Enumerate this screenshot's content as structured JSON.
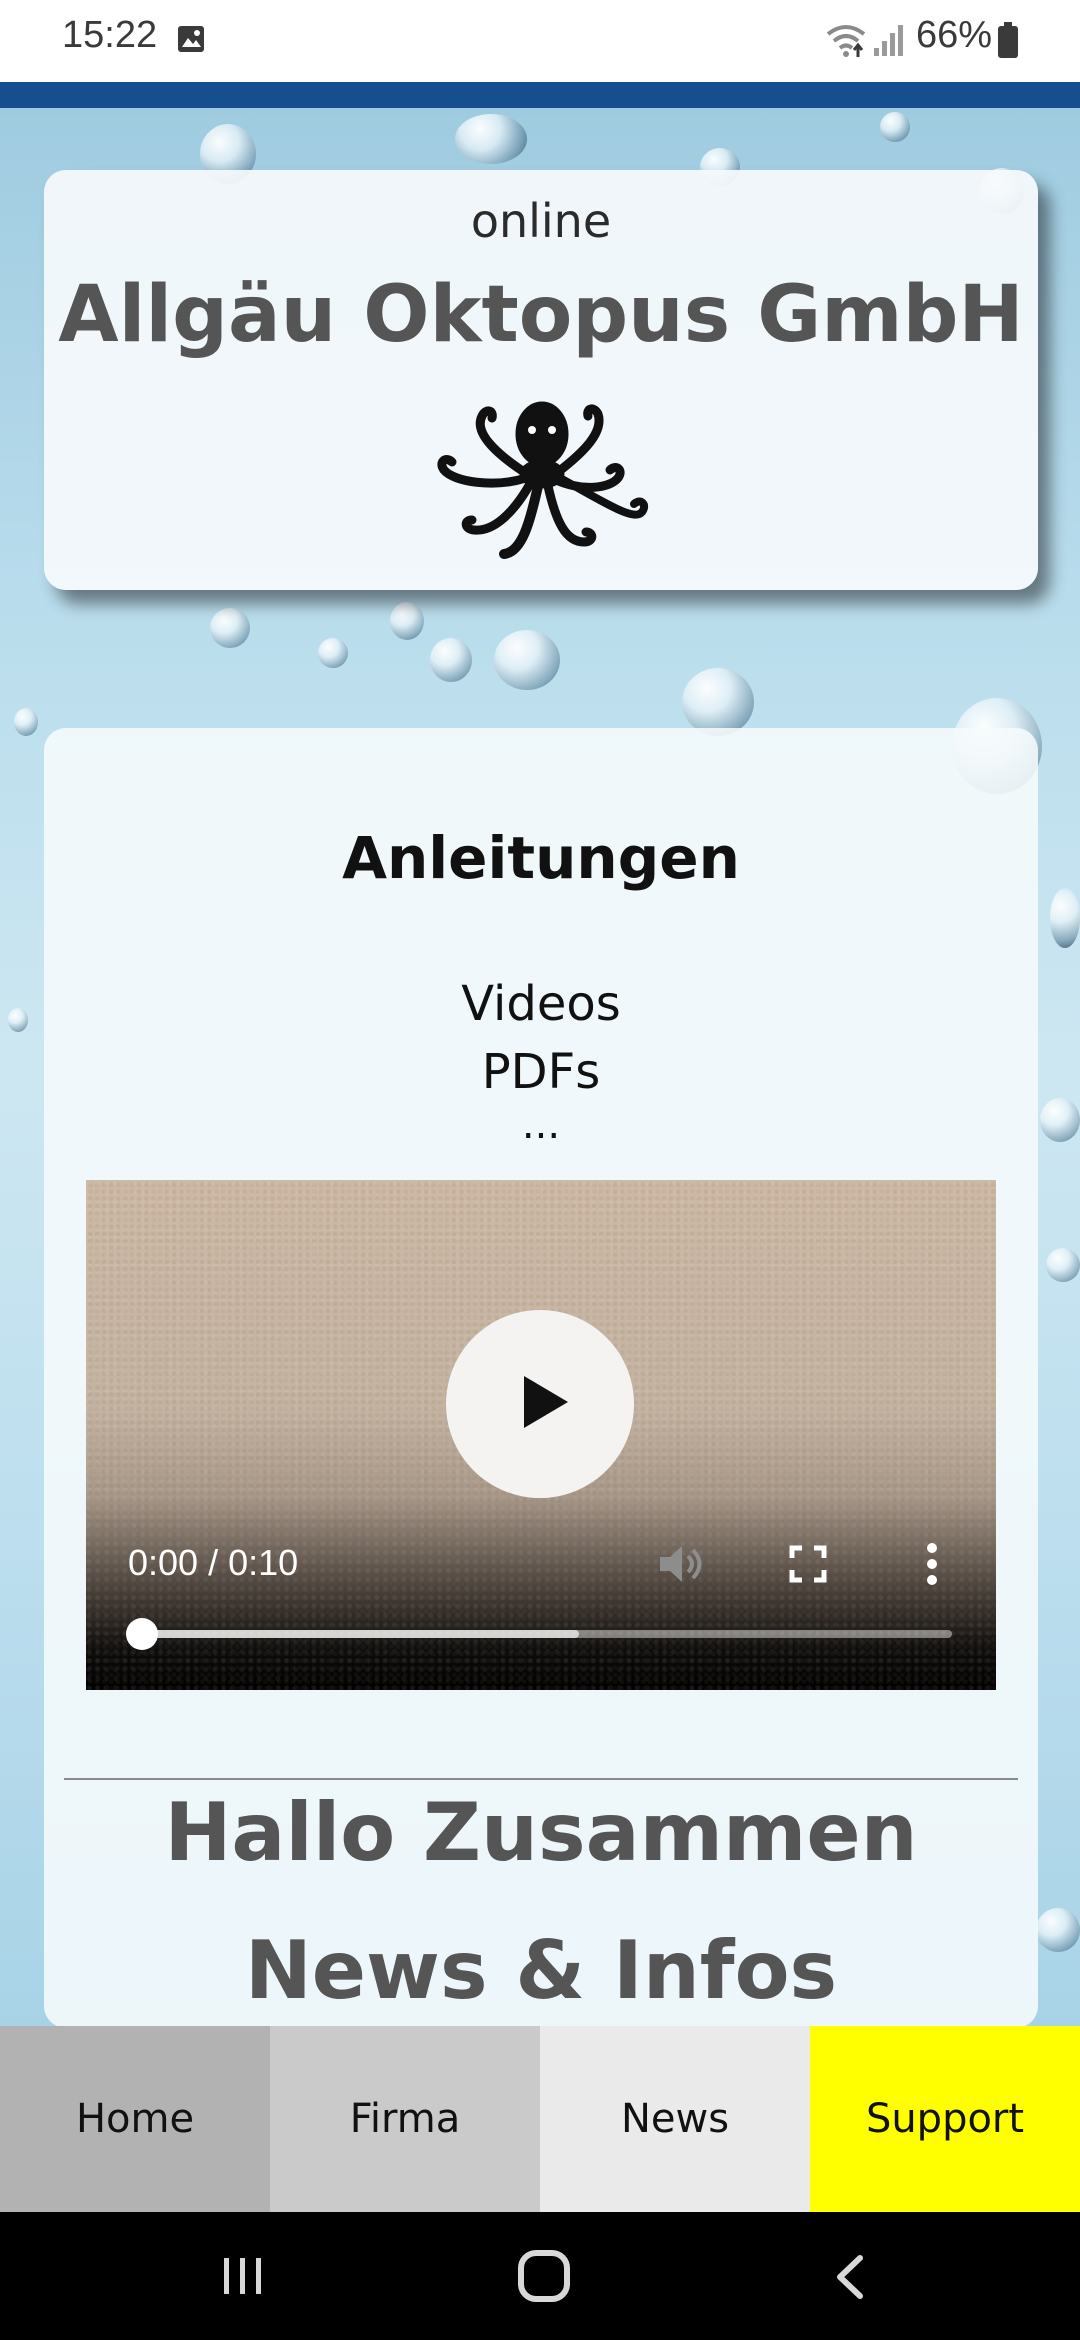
{
  "status_bar": {
    "time": "15:22",
    "battery": "66%",
    "icons": [
      "gallery-icon",
      "wifi-icon",
      "signal-icon",
      "battery-icon"
    ]
  },
  "header": {
    "online": "online",
    "company": "Allgäu Oktopus GmbH",
    "logo": "octopus-icon"
  },
  "main": {
    "section_title": "Anleitungen",
    "lines": [
      "Videos",
      "PDFs",
      "..."
    ],
    "video": {
      "time": "0:00 / 0:10",
      "progress": 0.0,
      "buffered": 0.54,
      "controls": [
        "play-icon",
        "volume-icon",
        "fullscreen-icon",
        "more-vert-icon"
      ]
    },
    "greeting": "Hallo Zusammen",
    "news_heading": "News & Infos"
  },
  "bottom_nav": {
    "home": "Home",
    "firma": "Firma",
    "news": "News",
    "support": "Support"
  },
  "colors": {
    "top_stripe": "#164e8f",
    "support_bg": "#ffff00",
    "nav_home_bg": "#b2b2b2",
    "nav_firma_bg": "#cacaca",
    "nav_news_bg": "#eaeaea"
  }
}
